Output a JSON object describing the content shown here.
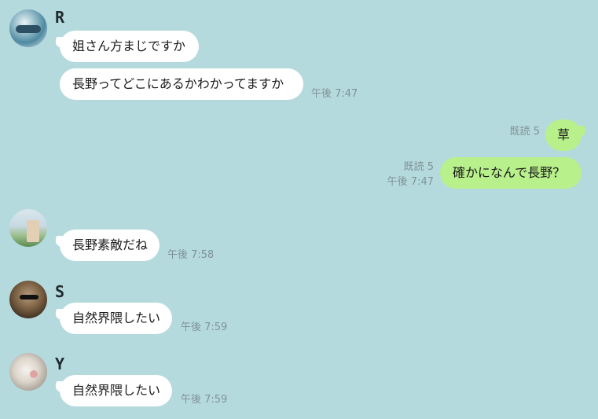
{
  "messages": [
    {
      "sender": "R",
      "text": "姐さん方まじですか"
    },
    {
      "text": "長野ってどこにあるかわかってますか",
      "time": "午後 7:47"
    },
    {
      "me": true,
      "read": "既読 5",
      "text": "草"
    },
    {
      "me": true,
      "read": "既読 5",
      "time": "午後 7:47",
      "text": "確かになんで長野？"
    },
    {
      "text": "長野素敵だね",
      "time": "午後 7:58"
    },
    {
      "sender": "S",
      "text": "自然界隈したい",
      "time": "午後 7:59"
    },
    {
      "sender": "Y",
      "text": "自然界隈したい",
      "time": "午後 7:59"
    }
  ],
  "colors": {
    "background": "#b5dade",
    "incoming_bubble": "#ffffff",
    "outgoing_bubble": "#b8f08b",
    "meta_text": "#7f9396"
  }
}
